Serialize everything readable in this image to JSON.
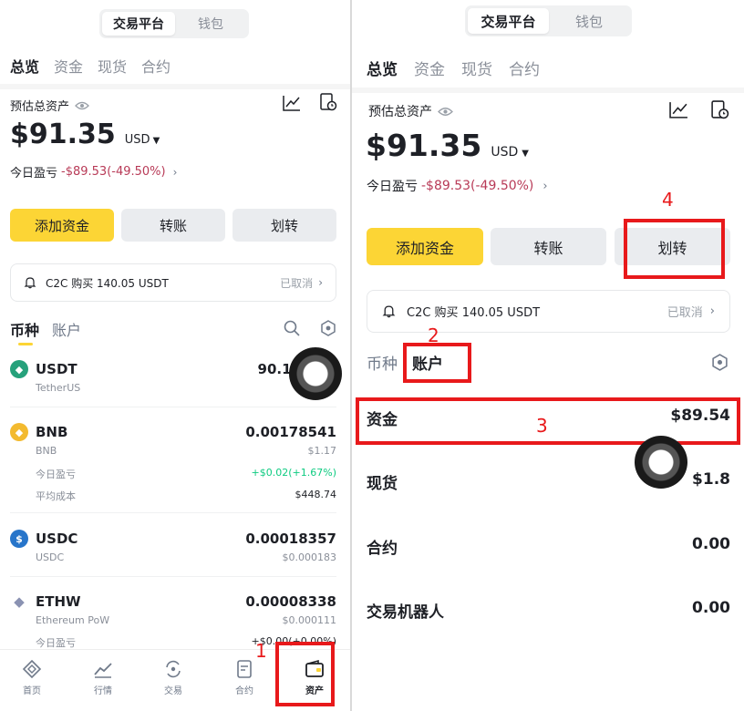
{
  "segment": {
    "exchange": "交易平台",
    "wallet": "钱包"
  },
  "tabs": [
    "总览",
    "资金",
    "现货",
    "合约"
  ],
  "summary": {
    "label": "预估总资产",
    "amount": "$91.35",
    "currency": "USD",
    "pnl_label": "今日盈亏",
    "pnl_value": "-$89.53(-49.50%)"
  },
  "buttons": {
    "add": "添加资金",
    "transfer": "转账",
    "move": "划转"
  },
  "notice": {
    "text": "C2C 购买 140.05 USDT",
    "status": "已取消"
  },
  "list_tabs": {
    "coin": "币种",
    "account": "账户"
  },
  "coins": [
    {
      "symbol": "USDT",
      "name": "TetherUS",
      "amount": "90.18",
      "icon": "usdt-icon",
      "color": "#26a17b"
    },
    {
      "symbol": "BNB",
      "name": "BNB",
      "amount": "0.00178541",
      "usd": "$1.17",
      "pnl_label": "今日盈亏",
      "pnl": "+$0.02(+1.67%)",
      "cost_label": "平均成本",
      "cost": "$448.74",
      "icon": "bnb-icon",
      "color": "#f3ba2f"
    },
    {
      "symbol": "USDC",
      "name": "USDC",
      "amount": "0.00018357",
      "usd": "$0.000183",
      "icon": "usdc-icon",
      "color": "#2775ca"
    },
    {
      "symbol": "ETHW",
      "name": "Ethereum PoW",
      "amount": "0.00008338",
      "usd": "$0.000111",
      "pnl_label": "今日盈亏",
      "pnl": "+$0.00(+0.00%)",
      "icon": "ethw-icon",
      "color": "#8a92b2"
    }
  ],
  "nav": [
    {
      "label": "首页",
      "icon": "home-icon"
    },
    {
      "label": "行情",
      "icon": "markets-icon"
    },
    {
      "label": "交易",
      "icon": "trade-icon"
    },
    {
      "label": "合约",
      "icon": "futures-icon"
    },
    {
      "label": "资产",
      "icon": "wallet-icon"
    }
  ],
  "accounts": [
    {
      "name": "资金",
      "value": "$89.54"
    },
    {
      "name": "现货",
      "value": "$1.8"
    },
    {
      "name": "合约",
      "value": "0.00"
    },
    {
      "name": "交易机器人",
      "value": "0.00"
    }
  ],
  "annotations": [
    "1",
    "2",
    "3",
    "4"
  ],
  "colors": {
    "accent": "#fcd535",
    "loss": "#b83a57",
    "gain": "#0ecb81",
    "annotation": "#e8191b"
  }
}
